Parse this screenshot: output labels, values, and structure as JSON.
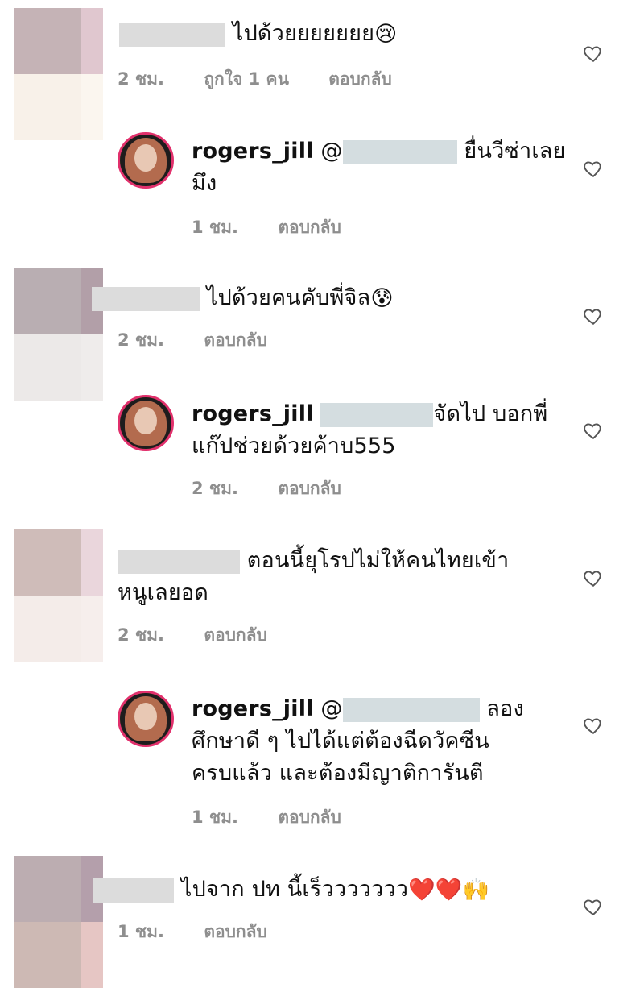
{
  "comments": [
    {
      "text": "ไปด้วยยยยยยย",
      "emoji": "😢",
      "time": "2 ชม.",
      "likes": "ถูกใจ 1 คน",
      "reply": "ตอบกลับ"
    },
    {
      "user": "rogers_jill",
      "at": "@",
      "text_line1": "ยื่นวีซ่าเลย",
      "text_line2": "มึง",
      "time": "1 ชม.",
      "reply": "ตอบกลับ"
    },
    {
      "text": "ไปด้วยคนคับพี่จิล",
      "emoji": "😰",
      "time": "2 ชม.",
      "reply": "ตอบกลับ"
    },
    {
      "user": "rogers_jill",
      "text_line1": "จัดไป บอกพี่",
      "text_line2": "แก๊ปช่วยด้วยค้าบ555",
      "time": "2 ชม.",
      "reply": "ตอบกลับ"
    },
    {
      "text_line1": "ตอนนี้ยุโรปไม่ให้คนไทยเข้า",
      "text_line2": "หนูเลยอด",
      "time": "2 ชม.",
      "reply": "ตอบกลับ"
    },
    {
      "user": "rogers_jill",
      "at": "@",
      "text_line1": "ลอง",
      "text_line2": "ศึกษาดี ๆ ไปได้แต่ต้องฉีดวัคซีน",
      "text_line3": "ครบแล้ว และต้องมีญาติการันตี",
      "time": "1 ชม.",
      "reply": "ตอบกลับ"
    },
    {
      "text": "ไปจาก ปท นี้เร็ววววววว",
      "emoji": "❤️❤️🙌",
      "time": "1 ชม.",
      "reply": "ตอบกลับ"
    }
  ],
  "colors": {
    "meta_gray": "#8e8e8e",
    "ring_pink": "#e1306c",
    "mask_blue": "#d4dde0"
  },
  "icons": {
    "like": "heart-outline-icon"
  }
}
